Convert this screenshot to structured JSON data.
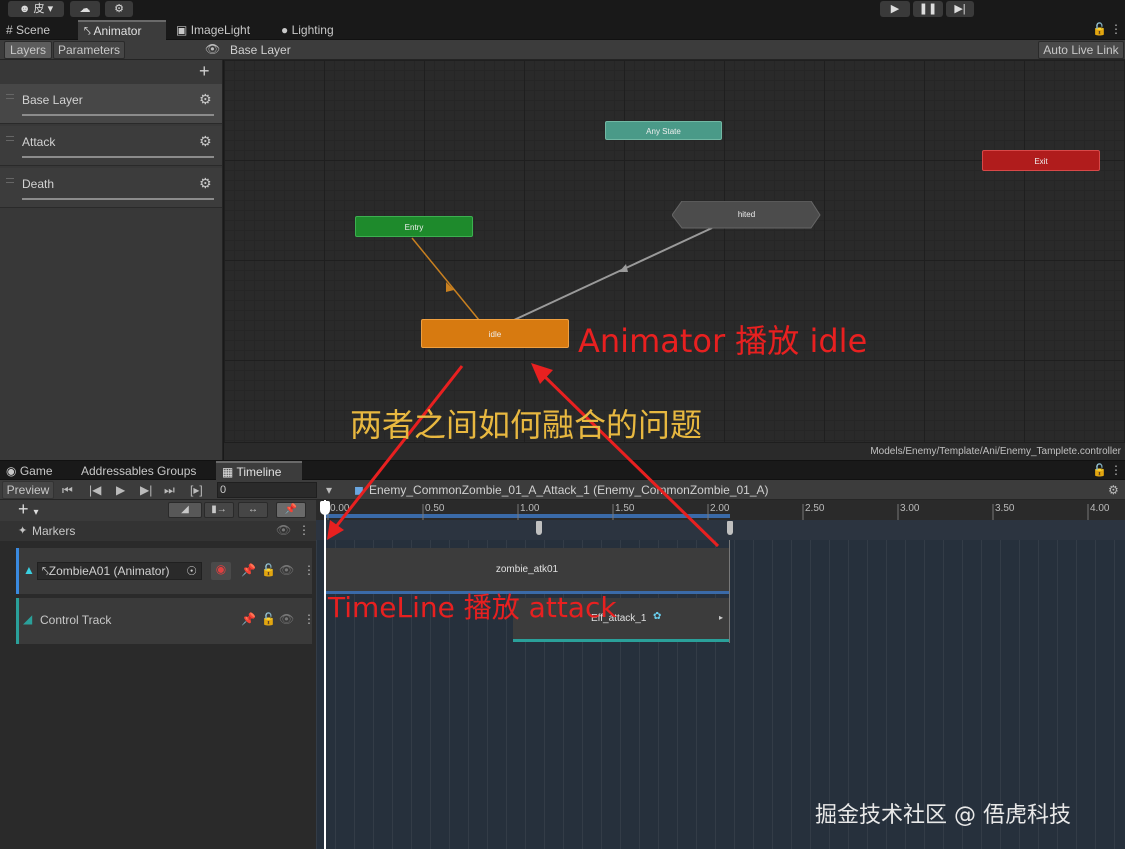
{
  "toolbar": {
    "account_label": "皮",
    "play_icon": "play-icon",
    "pause_icon": "pause-icon",
    "step_icon": "step-icon"
  },
  "upper_tabs": [
    {
      "label": "Scene"
    },
    {
      "label": "Animator"
    },
    {
      "label": "ImageLight"
    },
    {
      "label": "Lighting"
    }
  ],
  "animator": {
    "layers_tab": "Layers",
    "parameters_tab": "Parameters",
    "breadcrumb": "Base Layer",
    "auto_live_link": "Auto Live Link",
    "layers": [
      {
        "name": "Base Layer"
      },
      {
        "name": "Attack"
      },
      {
        "name": "Death"
      }
    ],
    "nodes": {
      "any_state": "Any State",
      "exit": "Exit",
      "entry": "Entry",
      "hited": "hited",
      "idle": "idle"
    },
    "path": "Models/Enemy/Template/Ani/Enemy_Tamplete.controller",
    "colors": {
      "entry": "#1e8a2c",
      "any_state": "#4ea08e",
      "exit": "#b81c1c",
      "idle": "#d77a10",
      "hited": "#505050"
    }
  },
  "lower_tabs": [
    {
      "label": "Game"
    },
    {
      "label": "Addressables Groups"
    },
    {
      "label": "Timeline"
    }
  ],
  "timeline": {
    "preview": "Preview",
    "frame_value": "0",
    "asset": "Enemy_CommonZombie_01_A_Attack_1 (Enemy_CommonZombie_01_A)",
    "ruler": [
      "0.00",
      "0.50",
      "1.00",
      "1.50",
      "2.00",
      "2.50",
      "3.00",
      "3.50",
      "4.00"
    ],
    "markers": "Markers",
    "tracks": [
      {
        "name": "ZombieA01 (Animator)",
        "clip": "zombie_atk01"
      },
      {
        "name": "Control Track",
        "clip": "Eff_attack_1"
      }
    ]
  },
  "annotations": {
    "animator_plays": "Animator 播放 idle",
    "question": "两者之间如何融合的问题",
    "timeline_plays": "TimeLine 播放 attack"
  },
  "watermark": "掘金技术社区 @ 俉虎科技"
}
